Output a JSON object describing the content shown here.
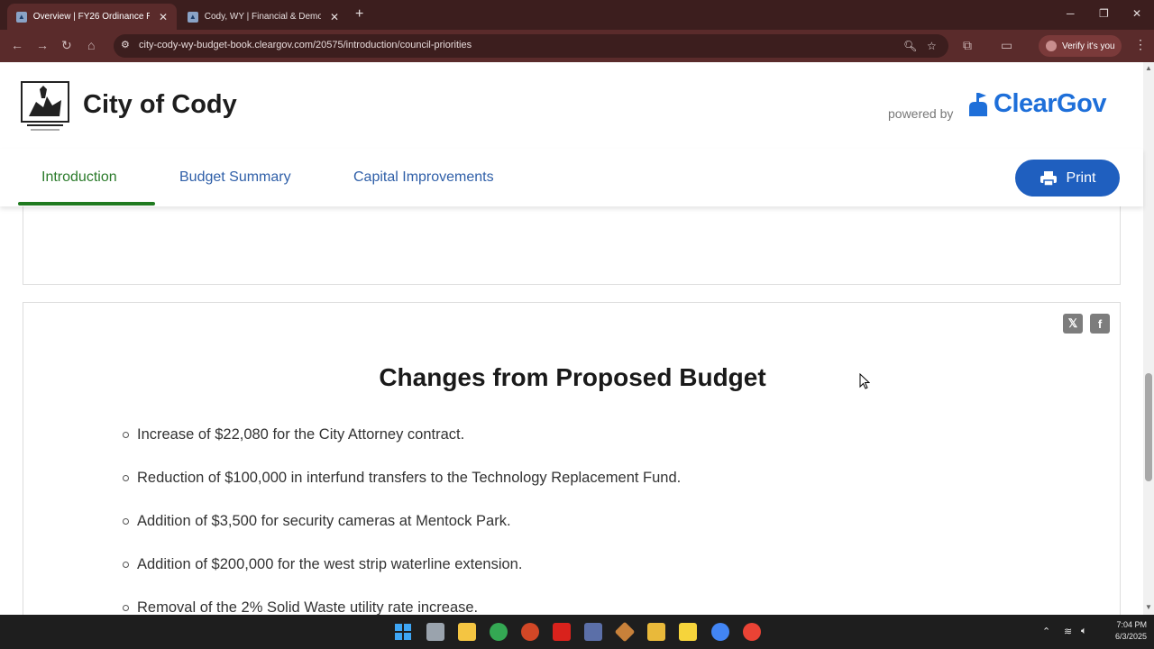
{
  "browser": {
    "tabs": [
      {
        "title": "Overview | FY26 Ordinance Rea",
        "active": true
      },
      {
        "title": "Cody, WY | Financial & Demogr",
        "active": false
      }
    ],
    "url": "city-cody-wy-budget-book.cleargov.com/20575/introduction/council-priorities",
    "verify_label": "Verify it's you"
  },
  "site": {
    "title": "City of Cody",
    "powered_by": "powered by",
    "brand": "ClearGov",
    "brand_color": "#1e6fd9"
  },
  "nav": {
    "items": [
      {
        "label": "Introduction",
        "active": true
      },
      {
        "label": "Budget Summary",
        "active": false
      },
      {
        "label": "Capital Improvements",
        "active": false
      }
    ],
    "print_label": "Print"
  },
  "section": {
    "title": "Changes from Proposed Budget",
    "items": [
      "Increase of $22,080 for the City Attorney contract.",
      "Reduction of $100,000 in interfund transfers to the Technology Replacement Fund.",
      "Addition of $3,500 for security cameras at Mentock Park.",
      "Addition of $200,000 for the west strip waterline extension.",
      "Removal of the 2% Solid Waste utility rate increase."
    ]
  },
  "taskbar": {
    "time": "7:04 PM",
    "date": "6/3/2025"
  }
}
